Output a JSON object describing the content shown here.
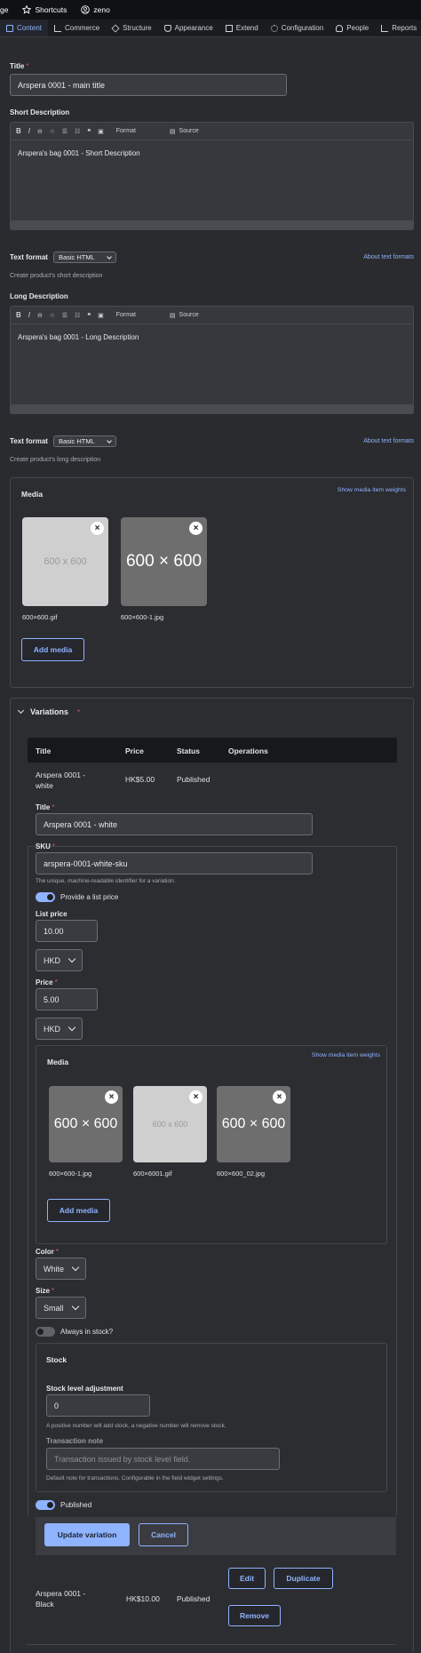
{
  "toolbar": {
    "cut_label": "ge",
    "shortcuts": "Shortcuts",
    "user": "zeno"
  },
  "admin_tabs": [
    "Content",
    "Commerce",
    "Structure",
    "Appearance",
    "Extend",
    "Configuration",
    "People",
    "Reports"
  ],
  "title_field": {
    "label": "Title",
    "value": "Arspera 0001 - main title"
  },
  "short_desc": {
    "label": "Short Description",
    "toolbar": {
      "format": "Format",
      "source": "Source"
    },
    "content": "Arspera's bag 0001 - Short Description",
    "text_format_label": "Text format",
    "text_format_value": "Basic HTML",
    "about": "About text formats",
    "help": "Create product's short description"
  },
  "long_desc": {
    "label": "Long Description",
    "toolbar": {
      "format": "Format",
      "source": "Source"
    },
    "content": "Arspera's bag 0001 - Long Description",
    "text_format_label": "Text format",
    "text_format_value": "Basic HTML",
    "about": "About text formats",
    "help": "Create product's long description"
  },
  "media": {
    "title": "Media",
    "weights_link": "Show media item weights",
    "items": [
      {
        "placeholder": "600 x 600",
        "name": "600×600.gif",
        "style": "light"
      },
      {
        "placeholder": "600 × 600",
        "name": "600×600-1.jpg",
        "style": "dark"
      }
    ],
    "add_button": "Add media"
  },
  "variations": {
    "title": "Variations",
    "headers": [
      "Title",
      "Price",
      "Status",
      "Operations"
    ],
    "rows": [
      {
        "title": "Arspera 0001 - white",
        "price": "HK$5.00",
        "status": "Published"
      },
      {
        "title": "Arspera 0001 - Black",
        "price": "HK$10.00",
        "status": "Published",
        "ops": [
          "Edit",
          "Duplicate",
          "Remove"
        ]
      }
    ]
  },
  "variation_form": {
    "title_label": "Title",
    "title_value": "Arspera 0001 - white",
    "sku_label": "SKU",
    "sku_value": "arspera-0001-white-sku",
    "sku_help": "The unique, machine-readable identifier for a variation.",
    "list_price_toggle": "Provide a list price",
    "list_price_label": "List price",
    "list_price_value": "10.00",
    "list_currency": "HKD",
    "price_label": "Price",
    "price_value": "5.00",
    "price_currency": "HKD",
    "media": {
      "title": "Media",
      "weights_link": "Show media item weights",
      "items": [
        {
          "placeholder": "600 × 600",
          "name": "600×600-1.jpg",
          "style": "dark"
        },
        {
          "placeholder": "600 x 600",
          "name": "600×6001.gif",
          "style": "light"
        },
        {
          "placeholder": "600 × 600",
          "name": "600×600_02.jpg",
          "style": "dark"
        }
      ],
      "add_button": "Add media"
    },
    "color_label": "Color",
    "color_value": "White",
    "size_label": "Size",
    "size_value": "Small",
    "always_in_stock": "Always in stock?",
    "stock": {
      "title": "Stock",
      "adjust_label": "Stock level adjustment",
      "adjust_value": "0",
      "adjust_help": "A positive number will add stock, a negative number will remove stock.",
      "note_label": "Transaction note",
      "note_placeholder": "Transaction issued by stock level field.",
      "note_help": "Default note for transactions. Configurable in the field widget settings."
    },
    "published": "Published",
    "update_button": "Update variation",
    "cancel_button": "Cancel"
  },
  "colors": {
    "accent": "#8fb3ff",
    "bg": "#2a2b2f",
    "required": "#e05a5a"
  }
}
